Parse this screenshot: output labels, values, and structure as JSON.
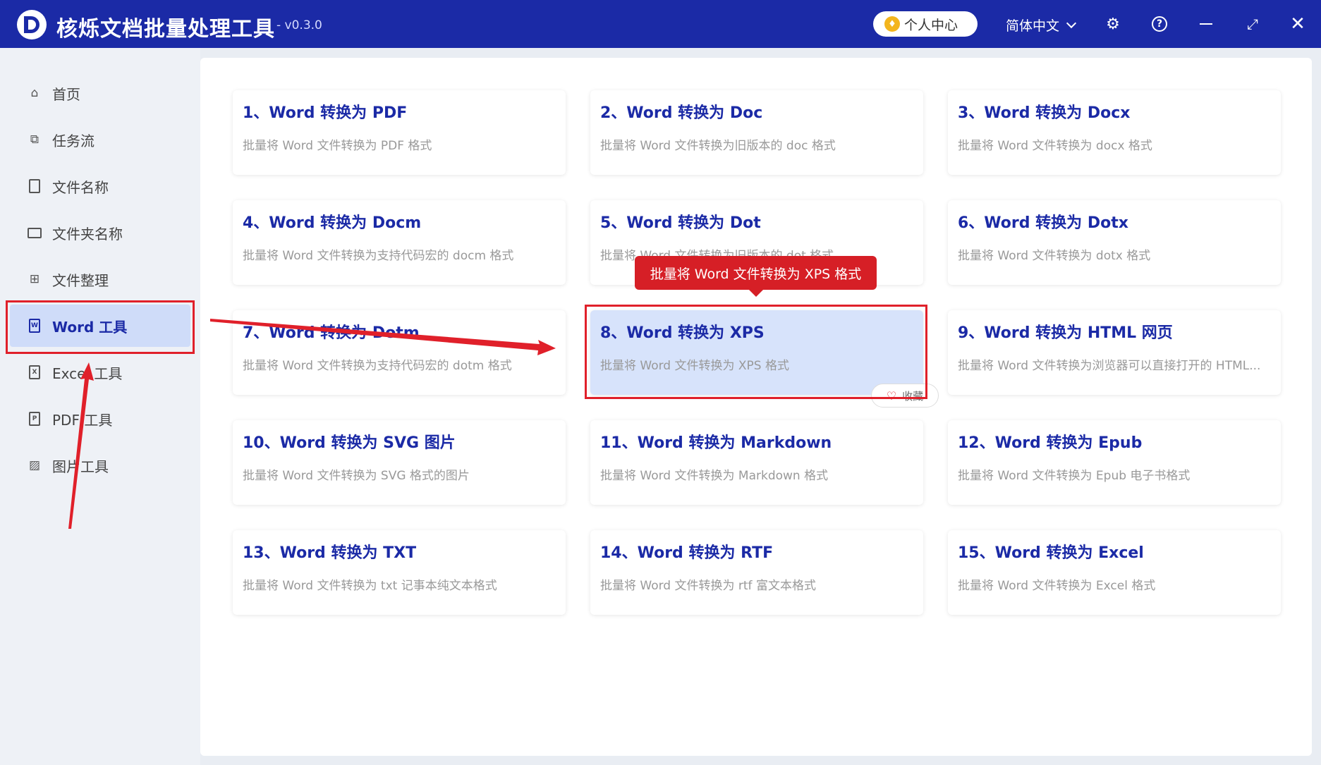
{
  "app": {
    "title": "核烁文档批量处理工具",
    "version": "- v0.3.0",
    "user_center": "个人中心",
    "language": "简体中文"
  },
  "colors": {
    "brand": "#1b2aa6",
    "annotation_red": "#e0202a"
  },
  "sidebar": {
    "items": [
      {
        "label": "首页",
        "icon": "home-icon"
      },
      {
        "label": "任务流",
        "icon": "workflow-icon"
      },
      {
        "label": "文件名称",
        "icon": "file-name-icon"
      },
      {
        "label": "文件夹名称",
        "icon": "folder-icon"
      },
      {
        "label": "文件整理",
        "icon": "organize-icon"
      },
      {
        "label": "Word 工具",
        "icon": "word-doc-icon",
        "active": true
      },
      {
        "label": "Excel 工具",
        "icon": "excel-doc-icon"
      },
      {
        "label": "PDF 工具",
        "icon": "pdf-doc-icon"
      },
      {
        "label": "图片工具",
        "icon": "image-icon"
      }
    ]
  },
  "cards": [
    {
      "title": "1、Word 转换为 PDF",
      "desc": "批量将 Word 文件转换为 PDF 格式"
    },
    {
      "title": "2、Word 转换为 Doc",
      "desc": "批量将 Word 文件转换为旧版本的 doc 格式"
    },
    {
      "title": "3、Word 转换为 Docx",
      "desc": "批量将 Word 文件转换为 docx 格式"
    },
    {
      "title": "4、Word 转换为 Docm",
      "desc": "批量将 Word 文件转换为支持代码宏的 docm 格式"
    },
    {
      "title": "5、Word 转换为 Dot",
      "desc": "批量将 Word 文件转换为旧版本的 dot 格式"
    },
    {
      "title": "6、Word 转换为 Dotx",
      "desc": "批量将 Word 文件转换为 dotx 格式"
    },
    {
      "title": "7、Word 转换为 Dotm",
      "desc": "批量将 Word 文件转换为支持代码宏的 dotm 格式"
    },
    {
      "title": "8、Word 转换为 XPS",
      "desc": "批量将 Word 文件转换为 XPS 格式",
      "active": true
    },
    {
      "title": "9、Word 转换为 HTML 网页",
      "desc": "批量将 Word 文件转换为浏览器可以直接打开的 HTML..."
    },
    {
      "title": "10、Word 转换为 SVG 图片",
      "desc": "批量将 Word 文件转换为 SVG 格式的图片"
    },
    {
      "title": "11、Word 转换为 Markdown",
      "desc": "批量将 Word 文件转换为 Markdown 格式"
    },
    {
      "title": "12、Word 转换为 Epub",
      "desc": "批量将 Word 文件转换为 Epub 电子书格式"
    },
    {
      "title": "13、Word 转换为 TXT",
      "desc": "批量将 Word 文件转换为 txt 记事本纯文本格式"
    },
    {
      "title": "14、Word 转换为 RTF",
      "desc": "批量将 Word 文件转换为 rtf 富文本格式"
    },
    {
      "title": "15、Word 转换为 Excel",
      "desc": "批量将 Word 文件转换为 Excel 格式"
    }
  ],
  "tooltip": "批量将 Word 文件转换为 XPS 格式",
  "favorite_label": "收藏"
}
